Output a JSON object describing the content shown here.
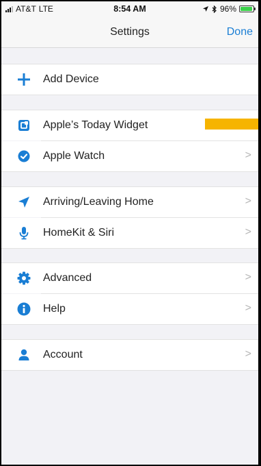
{
  "status_bar": {
    "carrier": "AT&T",
    "network": "LTE",
    "time": "8:54 AM",
    "battery": "96%",
    "battery_level": 0.96
  },
  "nav": {
    "title": "Settings",
    "done_label": "Done"
  },
  "rows": {
    "add_device": "Add Device",
    "today_widget": "Apple’s Today Widget",
    "apple_watch": "Apple Watch",
    "arriving_leaving": "Arriving/Leaving Home",
    "homekit_siri": "HomeKit & Siri",
    "advanced": "Advanced",
    "help": "Help",
    "account": "Account"
  },
  "chevron": ">",
  "colors": {
    "accent": "#1a7ed4",
    "highlight": "#f6b400",
    "battery": "#3bd14a"
  }
}
